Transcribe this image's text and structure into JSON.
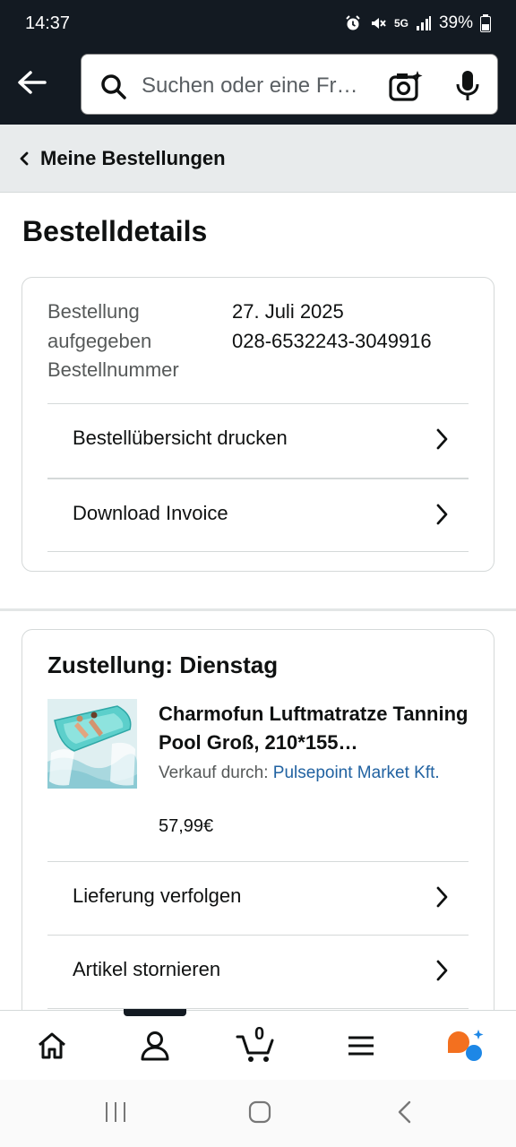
{
  "status_bar": {
    "time": "14:37",
    "network": "5G",
    "battery": "39%"
  },
  "header": {
    "search_placeholder": "Suchen oder eine Fr…"
  },
  "breadcrumb": {
    "label": "Meine Bestellungen"
  },
  "page": {
    "title": "Bestelldetails"
  },
  "order_info": {
    "placed_label_line1": "Bestellung",
    "placed_label_line2": "aufgegeben",
    "number_label": "Bestellnummer",
    "date": "27. Juli 2025",
    "number": "028-6532243-3049916"
  },
  "order_actions": [
    {
      "label": "Bestellübersicht drucken"
    },
    {
      "label": "Download Invoice"
    }
  ],
  "delivery": {
    "title": "Zustellung: Dienstag",
    "product_title": "Charmofun Luftmatratze Tanning Pool Groß, 210*155…",
    "sold_by_prefix": "Verkauf durch: ",
    "seller": "Pulsepoint Market Kft.",
    "price": "57,99€",
    "actions": [
      {
        "label": "Lieferung verfolgen"
      },
      {
        "label": "Artikel stornieren"
      }
    ]
  },
  "bottom_nav": {
    "cart_count": "0"
  },
  "colors": {
    "header_bg": "#131a22",
    "link": "#2162a1",
    "rufus_orange": "#f3701f",
    "rufus_blue": "#1d87e6"
  }
}
